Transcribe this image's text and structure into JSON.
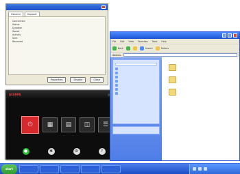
{
  "status_dialog": {
    "title": "",
    "tabs": [
      "General",
      "Support"
    ],
    "rows": [
      {
        "k": "Connection",
        "v": ""
      },
      {
        "k": "Status",
        "v": ""
      },
      {
        "k": "Duration",
        "v": ""
      },
      {
        "k": "Speed",
        "v": ""
      },
      {
        "k": "Activity",
        "v": ""
      },
      {
        "k": "Sent",
        "v": ""
      },
      {
        "k": "Received",
        "v": ""
      }
    ],
    "buttons": {
      "properties": "Properties",
      "disable": "Disable",
      "close": "Close"
    }
  },
  "media_window": {
    "logo": "ACERPA",
    "brand": "",
    "tiles": [
      "",
      "",
      "",
      "",
      ""
    ],
    "bottom_buttons": [
      {
        "label": "",
        "type": "green"
      },
      {
        "label": "",
        "type": "gray"
      },
      {
        "label": "",
        "type": "gray"
      },
      {
        "label": "",
        "type": "gray"
      }
    ]
  },
  "explorer": {
    "title": "",
    "menu": [
      "File",
      "Edit",
      "View",
      "Favorites",
      "Tools",
      "Help"
    ],
    "toolbar": {
      "back": "Back",
      "search": "Search",
      "folders": "Folders"
    },
    "address_label": "Address",
    "address_value": "",
    "task_pane": {
      "header": "",
      "items": [
        "",
        "",
        "",
        "",
        "",
        "",
        ""
      ]
    },
    "folders": [
      {
        "label": ""
      },
      {
        "label": ""
      },
      {
        "label": ""
      }
    ]
  },
  "taskbar": {
    "start": "start",
    "buttons": [
      "",
      "",
      "",
      "",
      ""
    ],
    "clock": ""
  },
  "colors": {
    "xp_blue": "#1c55d3",
    "start_green": "#2f9b2f",
    "media_red": "#d6292d"
  }
}
